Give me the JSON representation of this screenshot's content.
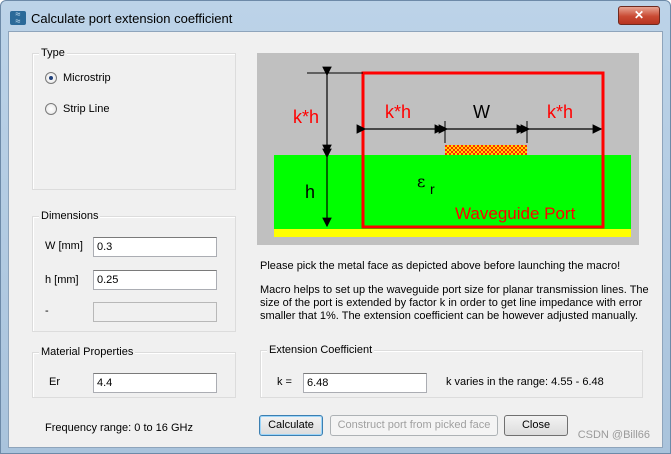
{
  "window": {
    "title": "Calculate port extension coefficient",
    "close_symbol": "✕"
  },
  "type_group": {
    "label": "Type",
    "options": [
      {
        "label": "Microstrip",
        "checked": true
      },
      {
        "label": "Strip Line",
        "checked": false
      }
    ]
  },
  "dimensions_group": {
    "label": "Dimensions",
    "w_label": "W [mm]",
    "w_value": "0.3",
    "h_label": "h [mm]",
    "h_value": "0.25",
    "third_label": "-",
    "third_value": ""
  },
  "material_group": {
    "label": "Material Properties",
    "er_label": "Er",
    "er_value": "4.4"
  },
  "frequency_text": "Frequency range: 0 to 16 GHz",
  "diagram": {
    "kh_left": "k*h",
    "kh_mid": "k*h",
    "kh_right": "k*h",
    "w_label": "W",
    "h_label": "h",
    "eps_symbol": "ε",
    "eps_sub": "r",
    "port_label": "Waveguide Port",
    "colors": {
      "background": "#c0c0c0",
      "substrate": "#00ff00",
      "ground": "#ffff00",
      "port": "#ff0000",
      "strip": "#ffd700"
    }
  },
  "instructions": {
    "line1": "Please pick the metal face as depicted above before launching the macro!",
    "para": [
      "Macro helps to set up the waveguide port size for planar transmission lines. The",
      "size of the port is extended by factor k in order to get line impedance with error",
      "smaller that 1%. The extension coefficient can be however adjusted manually."
    ]
  },
  "extension_group": {
    "label": "Extension Coefficient",
    "k_label": "k =",
    "k_value": "6.48",
    "range_text": "k varies in the range: 4.55 - 6.48"
  },
  "buttons": {
    "calculate": "Calculate",
    "construct": "Construct port from picked face",
    "close": "Close"
  },
  "watermark": "CSDN @Bill66"
}
